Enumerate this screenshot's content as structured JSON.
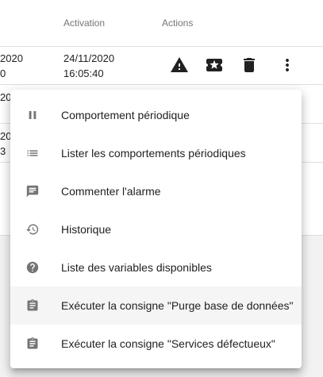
{
  "table": {
    "headers": {
      "activation": "Activation",
      "actions": "Actions"
    },
    "rows": [
      {
        "date_partial": "2020",
        "time_partial": "0",
        "activation_date": "24/11/2020",
        "activation_time": "16:05:40"
      },
      {
        "date_partial": "20",
        "time_partial": "",
        "activation_date": "",
        "activation_time": ""
      },
      {
        "date_partial": "20",
        "time_partial": "3",
        "activation_date": "",
        "activation_time": ""
      }
    ],
    "action_icons": [
      "warning-icon",
      "ticket-icon",
      "delete-icon",
      "more-vert-icon"
    ]
  },
  "menu": {
    "items": [
      {
        "label": "Comportement périodique",
        "icon": "pause-icon"
      },
      {
        "label": "Lister les comportements périodiques",
        "icon": "list-icon"
      },
      {
        "label": "Commenter l'alarme",
        "icon": "comment-icon"
      },
      {
        "label": "Historique",
        "icon": "history-icon"
      },
      {
        "label": "Liste des variables disponibles",
        "icon": "help-icon"
      },
      {
        "label": "Exécuter la consigne \"Purge base de données\"",
        "icon": "clipboard-icon",
        "hovered": true
      },
      {
        "label": "Exécuter la consigne \"Services défectueux\"",
        "icon": "clipboard-icon"
      }
    ]
  },
  "colors": {
    "menu_icon": "#757575",
    "action_icon": "#212121",
    "hover_bg": "#f5f5f5",
    "header_text": "#757575"
  }
}
